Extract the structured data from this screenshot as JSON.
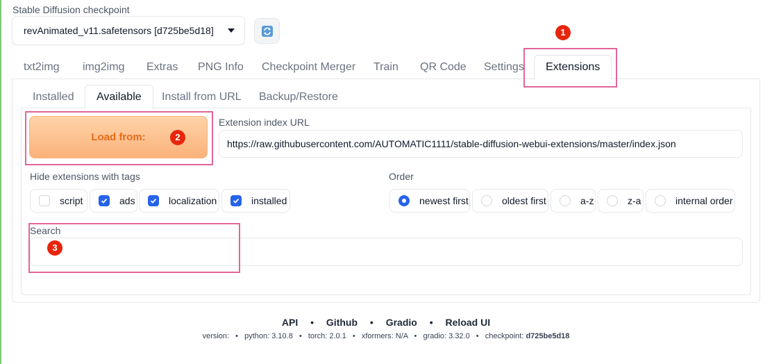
{
  "checkpoint": {
    "label": "Stable Diffusion checkpoint",
    "value": "revAnimated_v11.safetensors [d725be5d18]"
  },
  "main_tabs": [
    {
      "label": "txt2img"
    },
    {
      "label": "img2img"
    },
    {
      "label": "Extras"
    },
    {
      "label": "PNG Info"
    },
    {
      "label": "Checkpoint Merger"
    },
    {
      "label": "Train"
    },
    {
      "label": "QR Code"
    },
    {
      "label": "Settings"
    },
    {
      "label": "Extensions",
      "active": true
    }
  ],
  "sub_tabs": [
    {
      "label": "Installed"
    },
    {
      "label": "Available",
      "active": true
    },
    {
      "label": "Install from URL"
    },
    {
      "label": "Backup/Restore"
    }
  ],
  "load_button": {
    "label": "Load from:"
  },
  "extension_index": {
    "label": "Extension index URL",
    "value": "https://raw.githubusercontent.com/AUTOMATIC1111/stable-diffusion-webui-extensions/master/index.json"
  },
  "hide_tags": {
    "label": "Hide extensions with tags",
    "options": [
      {
        "label": "script",
        "checked": false
      },
      {
        "label": "ads",
        "checked": true
      },
      {
        "label": "localization",
        "checked": true
      },
      {
        "label": "installed",
        "checked": true
      }
    ]
  },
  "order": {
    "label": "Order",
    "options": [
      {
        "label": "newest first",
        "selected": true
      },
      {
        "label": "oldest first",
        "selected": false
      },
      {
        "label": "a-z",
        "selected": false
      },
      {
        "label": "z-a",
        "selected": false
      },
      {
        "label": "internal order",
        "selected": false
      }
    ]
  },
  "search": {
    "label": "Search",
    "value": ""
  },
  "annotations": {
    "marker1": "1",
    "marker2": "2",
    "marker3": "3",
    "highlight_color": "#e2659a",
    "marker_color": "#e8250c"
  },
  "footer": {
    "links": [
      "API",
      "Github",
      "Gradio",
      "Reload UI"
    ],
    "separator": "•",
    "version_label": "version:",
    "python": "python: 3.10.8",
    "torch": "torch: 2.0.1",
    "xformers": "xformers: N/A",
    "gradio": "gradio: 3.32.0",
    "checkpoint_label": "checkpoint:",
    "checkpoint_value": "d725be5d18"
  },
  "colors": {
    "accent": "#2563eb",
    "load_text": "#e46a1a"
  }
}
